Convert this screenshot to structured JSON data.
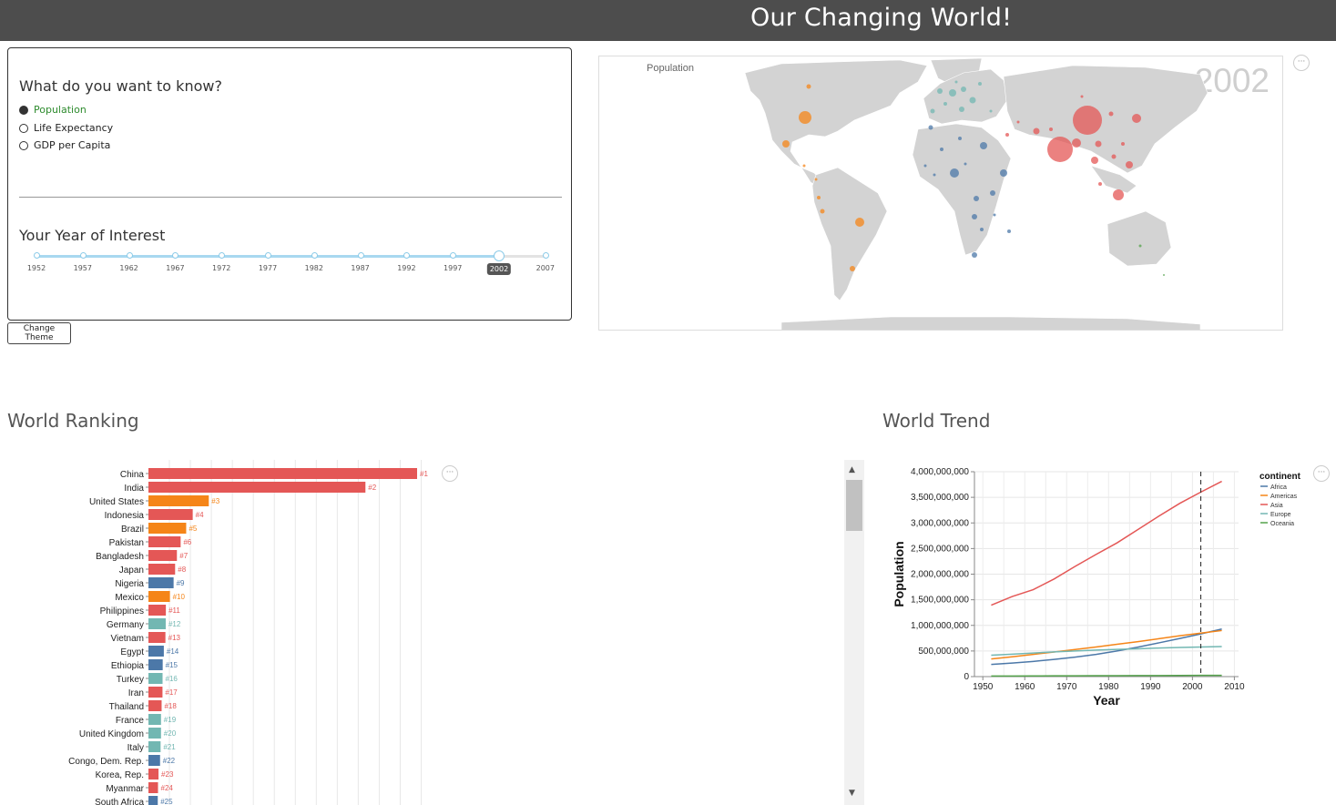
{
  "app": {
    "title": "Our Changing World!"
  },
  "panel": {
    "question": "What do you want to know?",
    "options": [
      {
        "label": "Population",
        "selected": true
      },
      {
        "label": "Life Expectancy",
        "selected": false
      },
      {
        "label": "GDP per Capita",
        "selected": false
      }
    ],
    "year_title": "Your Year of Interest",
    "years": [
      "1952",
      "1957",
      "1962",
      "1967",
      "1972",
      "1977",
      "1982",
      "1987",
      "1992",
      "1997",
      "2002",
      "2007"
    ],
    "selected_year": "2002"
  },
  "theme_button": "Change Theme",
  "map": {
    "label": "Population",
    "year": "2002",
    "menu": "···"
  },
  "ranking": {
    "title": "World Ranking",
    "menu": "···"
  },
  "trend": {
    "title": "World Trend",
    "menu": "···"
  },
  "colors": {
    "Africa": "#4c78a8",
    "Americas": "#f58518",
    "Asia": "#e45756",
    "Europe": "#72b7b2",
    "Oceania": "#54a24b"
  },
  "chart_data": [
    {
      "type": "bar",
      "title": "World Ranking",
      "value_field": "Population (2002)",
      "categories": [
        "China",
        "India",
        "United States",
        "Indonesia",
        "Brazil",
        "Pakistan",
        "Bangladesh",
        "Japan",
        "Nigeria",
        "Mexico",
        "Philippines",
        "Germany",
        "Vietnam",
        "Egypt",
        "Ethiopia",
        "Turkey",
        "Iran",
        "Thailand",
        "France",
        "United Kingdom",
        "Italy",
        "Congo, Dem. Rep.",
        "Korea, Rep.",
        "Myanmar",
        "South Africa"
      ],
      "values": [
        1280400000,
        1034172547,
        287675526,
        211060000,
        179914212,
        153403524,
        135656790,
        127065841,
        119901274,
        102479927,
        82995088,
        82350671,
        80908147,
        73312559,
        67946797,
        67308928,
        66907826,
        62806748,
        59925035,
        59912431,
        57926999,
        55379852,
        47969150,
        45598081,
        44433622
      ],
      "continents": [
        "Asia",
        "Asia",
        "Americas",
        "Asia",
        "Americas",
        "Asia",
        "Asia",
        "Asia",
        "Africa",
        "Americas",
        "Asia",
        "Europe",
        "Asia",
        "Africa",
        "Africa",
        "Europe",
        "Asia",
        "Asia",
        "Europe",
        "Europe",
        "Europe",
        "Africa",
        "Asia",
        "Asia",
        "Africa"
      ],
      "ranks": [
        "#1",
        "#2",
        "#3",
        "#4",
        "#5",
        "#6",
        "#7",
        "#8",
        "#9",
        "#10",
        "#11",
        "#12",
        "#13",
        "#14",
        "#15",
        "#16",
        "#17",
        "#18",
        "#19",
        "#20",
        "#21",
        "#22",
        "#23",
        "#24",
        "#25"
      ]
    },
    {
      "type": "line",
      "xlabel": "Year",
      "ylabel": "Population",
      "x": [
        1952,
        1957,
        1962,
        1967,
        1972,
        1977,
        1982,
        1987,
        1992,
        1997,
        2002,
        2007
      ],
      "xlim": [
        1948,
        2011
      ],
      "ylim": [
        0,
        4000000000
      ],
      "x_ticks": [
        "1950",
        "1960",
        "1970",
        "1980",
        "1990",
        "2000",
        "2010"
      ],
      "y_ticks": [
        "0",
        "500,000,000",
        "1,000,000,000",
        "1,500,000,000",
        "2,000,000,000",
        "2,500,000,000",
        "3,000,000,000",
        "3,500,000,000",
        "4,000,000,000"
      ],
      "marker_year": 2002,
      "legend_title": "continent",
      "legend_position": "top-right",
      "series": [
        {
          "name": "Africa",
          "values": [
            237640501,
            264837738,
            296516865,
            335289489,
            379879541,
            433061021,
            499348587,
            574834110,
            659081517,
            743832984,
            833723916,
            929539692
          ]
        },
        {
          "name": "Americas",
          "values": [
            345152446,
            386953916,
            433270254,
            480746623,
            529384210,
            578067699,
            630290920,
            682753971,
            739274104,
            796900410,
            849772762,
            898871184
          ]
        },
        {
          "name": "Asia",
          "values": [
            1395357352,
            1562780599,
            1696357182,
            1905662900,
            2150972248,
            2384513556,
            2610135582,
            2871220762,
            3133292191,
            3383285500,
            3601802203,
            3811953827
          ]
        },
        {
          "name": "Europe",
          "values": [
            418120846,
            437890351,
            460355155,
            481178958,
            500635059,
            517164531,
            531266901,
            543094160,
            558142797,
            568944148,
            578223869,
            586098529
          ]
        },
        {
          "name": "Oceania",
          "values": [
            10686006,
            11941976,
            13283518,
            14600414,
            16106100,
            17239000,
            18394850,
            19574415,
            20919651,
            22241430,
            23454829,
            24549947
          ]
        }
      ]
    }
  ]
}
